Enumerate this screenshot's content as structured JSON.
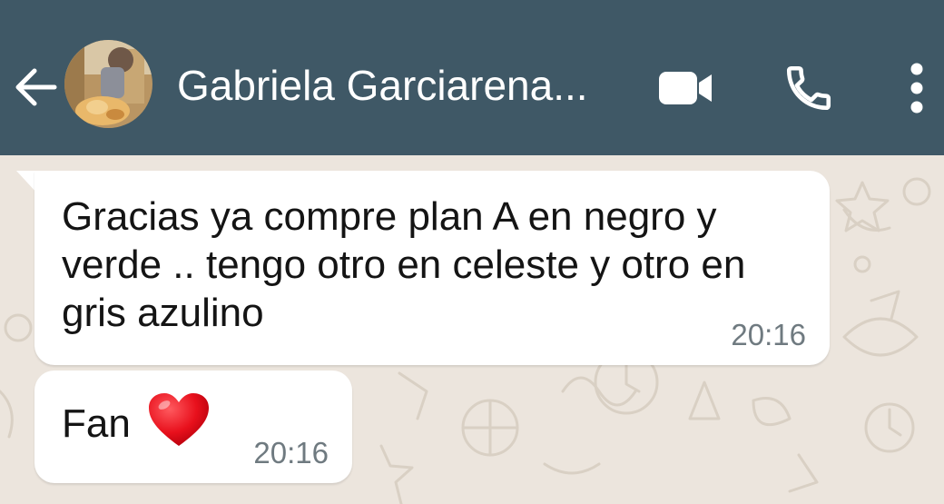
{
  "header": {
    "contact_name": "Gabriela Garciarena...",
    "back_icon": "arrow-left-icon",
    "video_icon": "video-camera-icon",
    "call_icon": "phone-icon",
    "menu_icon": "more-vert-icon",
    "background_color": "#3f5866"
  },
  "messages": [
    {
      "text": "Gracias ya compre plan A en negro y verde .. tengo otro en celeste y otro en gris azulino",
      "time": "20:16",
      "direction": "incoming"
    },
    {
      "text": "Fan",
      "emoji": "red-heart",
      "time": "20:16",
      "direction": "incoming"
    }
  ],
  "chat": {
    "background_color": "#ece5dd",
    "bubble_color": "#ffffff"
  }
}
